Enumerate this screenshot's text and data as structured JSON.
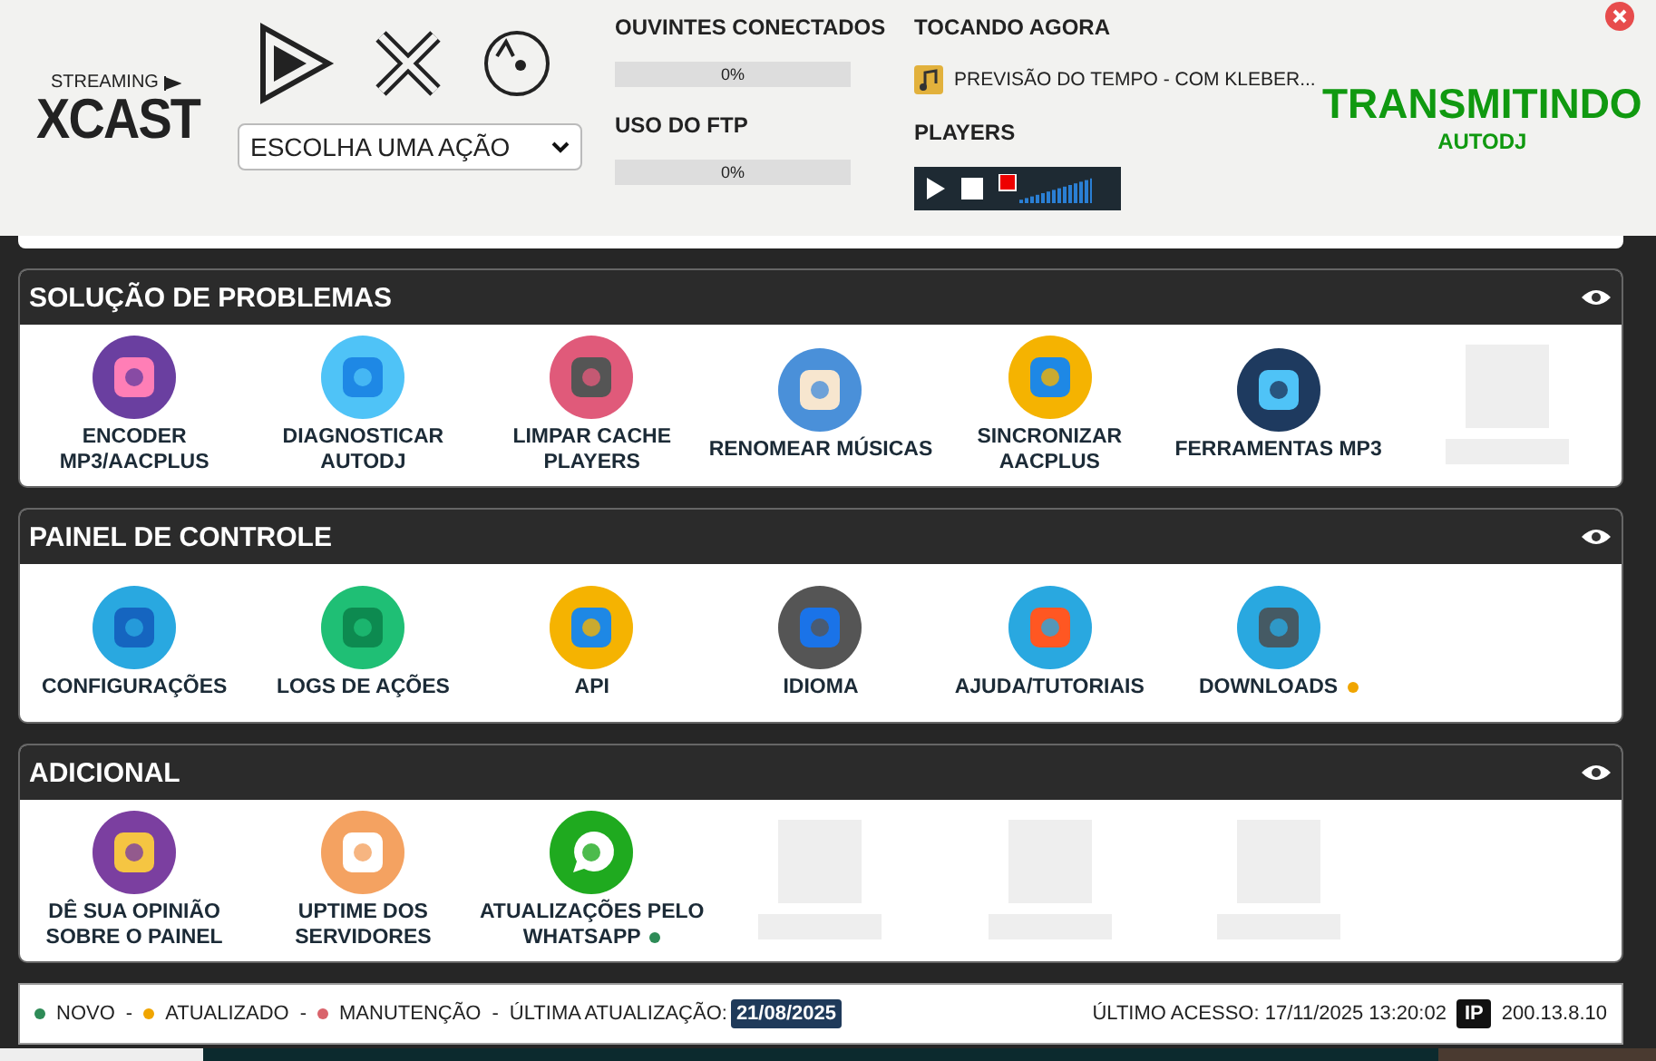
{
  "logo": {
    "small": "STREAMING",
    "big": "XCAST"
  },
  "action_select": {
    "value": "ESCOLHA UMA AÇÃO"
  },
  "stats": [
    {
      "label": "OUVINTES CONECTADOS",
      "level": 0,
      "reading": "0%"
    },
    {
      "label": "USO DO FTP",
      "level": 0,
      "reading": "0%"
    }
  ],
  "now_playing": {
    "label": "TOCANDO AGORA",
    "track": "PREVISÃO DO TEMPO - COM KLEBER..."
  },
  "players": {
    "label": "PLAYERS"
  },
  "status": {
    "title": "TRANSMITINDO",
    "subtitle": "AUTODJ"
  },
  "sections": [
    {
      "title": "SOLUÇÃO DE PROBLEMAS",
      "items": [
        {
          "kind": "tool",
          "label": "ENCODER MP3/AACPLUS"
        },
        {
          "kind": "tool",
          "label": "DIAGNOSTICAR AUTODJ"
        },
        {
          "kind": "tool",
          "label": "LIMPAR CACHE PLAYERS"
        },
        {
          "kind": "tool",
          "label": "RENOMEAR MÚSICAS"
        },
        {
          "kind": "tool",
          "label": "SINCRONIZAR AACPLUS"
        },
        {
          "kind": "tool",
          "label": "FERRAMENTAS MP3"
        },
        {
          "kind": "placeholder"
        }
      ]
    },
    {
      "title": "PAINEL DE CONTROLE",
      "items": [
        {
          "kind": "tool",
          "label": "CONFIGURAÇÕES"
        },
        {
          "kind": "tool",
          "label": "LOGS DE AÇÕES"
        },
        {
          "kind": "tool",
          "label": "API"
        },
        {
          "kind": "tool",
          "label": "IDIOMA"
        },
        {
          "kind": "tool",
          "label": "AJUDA/TUTORIAIS"
        },
        {
          "kind": "tool",
          "label": "DOWNLOADS",
          "color": "#f0a500"
        }
      ]
    },
    {
      "title": "ADICIONAL",
      "items": [
        {
          "kind": "tool",
          "label": "DÊ SUA OPINIÃO SOBRE O PAINEL"
        },
        {
          "kind": "tool",
          "label": "UPTIME DOS SERVIDORES"
        },
        {
          "kind": "tool",
          "label": "ATUALIZAÇÕES PELO WHATSAPP",
          "color": "#2e8b57"
        },
        {
          "kind": "placeholder"
        },
        {
          "kind": "placeholder"
        },
        {
          "kind": "placeholder"
        }
      ]
    }
  ],
  "legend": [
    {
      "label": "NOVO",
      "color": "#2e8b57",
      "separator": "-"
    },
    {
      "label": "ATUALIZADO",
      "color": "#f0a500",
      "separator": "-"
    },
    {
      "label": "MANUTENÇÃO",
      "color": "#d9636b",
      "separator": "-"
    }
  ],
  "last_update": {
    "label": "ÚLTIMA ATUALIZAÇÃO:",
    "date": "21/08/2025"
  },
  "last_access": "ÚLTIMO ACESSO: 17/11/2025 13:20:02",
  "ip": {
    "badge": "IP",
    "address": "200.13.8.10"
  }
}
